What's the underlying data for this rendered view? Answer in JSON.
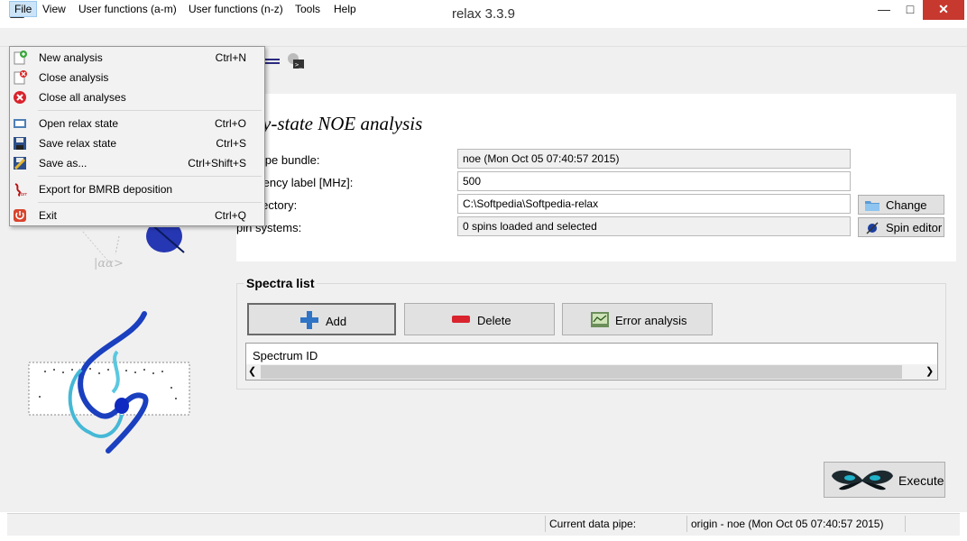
{
  "window": {
    "title": "relax 3.3.9"
  },
  "menubar": {
    "items": [
      "File",
      "View",
      "User functions (a-m)",
      "User functions (n-z)",
      "Tools",
      "Help"
    ]
  },
  "file_menu": {
    "items": [
      {
        "label": "New analysis",
        "shortcut": "Ctrl+N",
        "icon": "new-analysis-icon"
      },
      {
        "label": "Close analysis",
        "shortcut": "",
        "icon": "close-analysis-icon"
      },
      {
        "label": "Close all analyses",
        "shortcut": "",
        "icon": "close-all-icon"
      },
      {
        "label": "Open relax state",
        "shortcut": "Ctrl+O",
        "icon": "open-state-icon"
      },
      {
        "label": "Save relax state",
        "shortcut": "Ctrl+S",
        "icon": "save-state-icon"
      },
      {
        "label": "Save as...",
        "shortcut": "Ctrl+Shift+S",
        "icon": "save-as-icon"
      },
      {
        "label": "Export for BMRB deposition",
        "shortcut": "",
        "icon": "bmrb-icon"
      },
      {
        "label": "Exit",
        "shortcut": "Ctrl+Q",
        "icon": "exit-icon"
      }
    ]
  },
  "analysis": {
    "title": "ady-state NOE analysis",
    "fields": [
      {
        "label": "ata pipe bundle:",
        "value": "noe (Mon Oct 05 07:40:57 2015)",
        "readonly": true
      },
      {
        "label": "frequency label [MHz]:",
        "value": "500",
        "readonly": false
      },
      {
        "label": "ts directory:",
        "value": "C:\\Softpedia\\Softpedia-relax",
        "readonly": false
      },
      {
        "label": "pin systems:",
        "value": "0 spins loaded and selected",
        "readonly": true
      }
    ],
    "change_button": "Change",
    "spin_editor_button": "Spin editor"
  },
  "spectra": {
    "title": "Spectra list",
    "add_button": "Add",
    "delete_button": "Delete",
    "error_button": "Error analysis",
    "column_header": "Spectrum ID"
  },
  "execute_button": "Execute",
  "status": {
    "label": "Current data pipe:",
    "value": "origin - noe (Mon Oct 05 07:40:57 2015)"
  }
}
